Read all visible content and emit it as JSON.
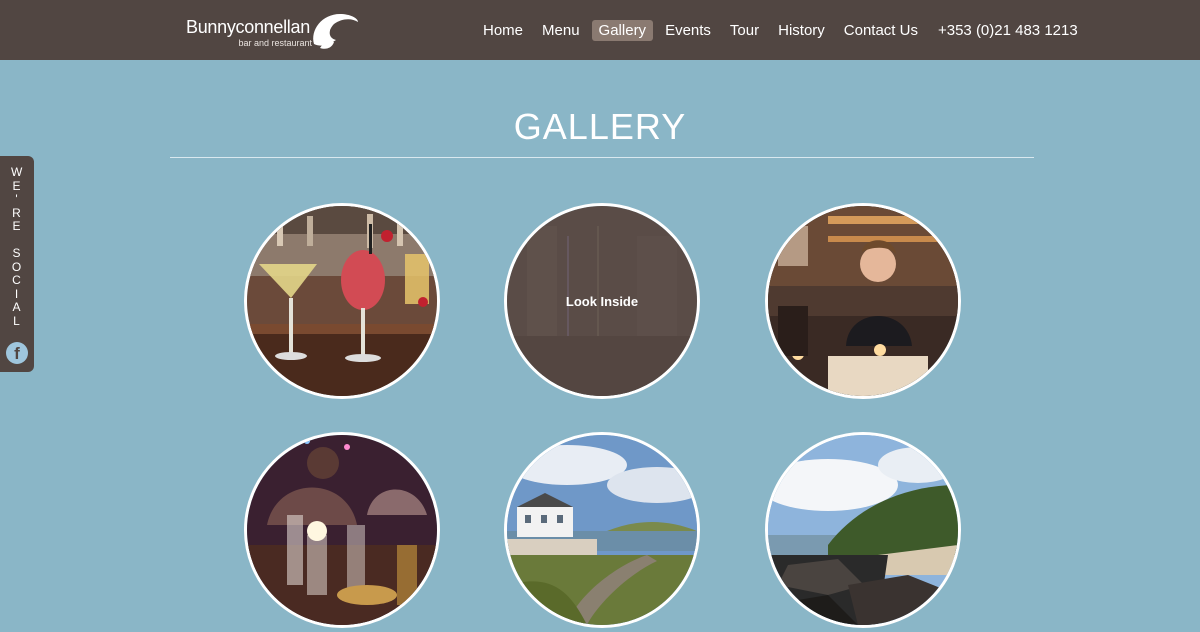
{
  "header": {
    "logo_name": "Bunnyconnellan",
    "logo_tagline": "bar and restaurant",
    "nav": [
      "Home",
      "Menu",
      "Gallery",
      "Events",
      "Tour",
      "History",
      "Contact Us"
    ],
    "active_nav": "Gallery",
    "phone": "+353 (0)21 483 1213"
  },
  "social": {
    "label_letters": [
      "W",
      "E",
      "'",
      "R",
      "E",
      " ",
      "S",
      "O",
      "C",
      "I",
      "A",
      "L"
    ],
    "fb_glyph": "f",
    "icon": "facebook-icon"
  },
  "page": {
    "title": "GALLERY"
  },
  "gallery": {
    "hover_label": "Look Inside",
    "items": [
      {
        "scene": "cocktails-on-bar",
        "icon": "photo"
      },
      {
        "scene": "restaurant-interior",
        "icon": "photo"
      },
      {
        "scene": "woman-at-bar",
        "icon": "photo"
      },
      {
        "scene": "dining-table-night",
        "icon": "photo"
      },
      {
        "scene": "coastal-building",
        "icon": "photo"
      },
      {
        "scene": "rocky-beach",
        "icon": "photo"
      }
    ]
  },
  "colors": {
    "header_bg": "#514642",
    "page_bg": "#8ab6c7",
    "active_nav_bg": "#8a7a71"
  }
}
